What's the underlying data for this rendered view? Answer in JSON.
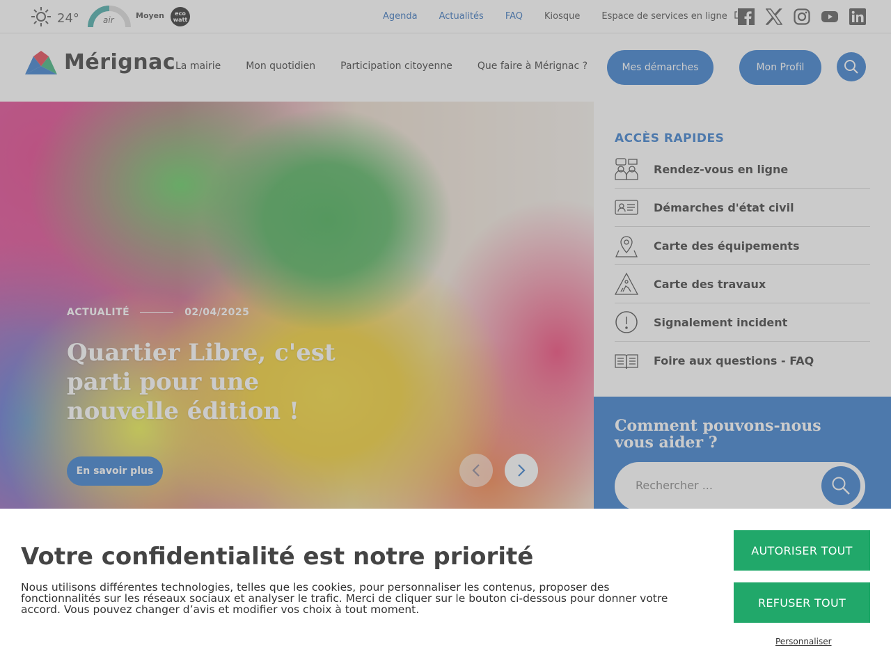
{
  "weather": {
    "icon": "sun-icon",
    "temperature": "24°"
  },
  "air_quality": {
    "label": "air",
    "level": "Moyen"
  },
  "ecowatt": {
    "line1": "eco",
    "line2": "watt"
  },
  "top_links": [
    {
      "label": "Agenda",
      "color": "#1a5fb4"
    },
    {
      "label": "Actualités",
      "color": "#1a5fb4"
    },
    {
      "label": "FAQ",
      "color": "#1a5fb4"
    },
    {
      "label": "Kiosque",
      "color": "#333333"
    },
    {
      "label": "Espace de services en ligne",
      "color": "#333333",
      "icon": "external-link-icon"
    }
  ],
  "socials": [
    "facebook-icon",
    "x-icon",
    "instagram-icon",
    "youtube-icon",
    "linkedin-icon"
  ],
  "header": {
    "logo_text": "Mérignac",
    "nav": [
      "La mairie",
      "Mon quotidien",
      "Participation citoyenne",
      "Que faire à Mérignac ?"
    ],
    "demarches_button": "Mes démarches",
    "profile_button": "Mon Profil"
  },
  "hero": {
    "category": "ACTUALITÉ",
    "date": "02/04/2025",
    "title": "Quartier Libre, c'est parti pour une nouvelle édition !",
    "cta": "En savoir plus"
  },
  "quick_access": {
    "title": "ACCÈS RAPIDES",
    "items": [
      {
        "label": "Rendez-vous en ligne",
        "icon": "appointment-icon"
      },
      {
        "label": "Démarches d'état civil",
        "icon": "id-card-icon"
      },
      {
        "label": "Carte des équipements",
        "icon": "map-pin-icon"
      },
      {
        "label": "Carte des travaux",
        "icon": "roadwork-icon"
      },
      {
        "label": "Signalement incident",
        "icon": "alert-icon"
      },
      {
        "label": "Foire aux questions - FAQ",
        "icon": "book-icon"
      }
    ]
  },
  "help": {
    "title": "Comment pouvons-nous vous aider ?",
    "placeholder": "Rechercher ..."
  },
  "cookie": {
    "title": "Votre confidentialité est notre priorité",
    "text": "Nous utilisons différentes technologies, telles que les cookies, pour personnaliser les contenus, proposer des fonctionnalités sur les réseaux sociaux et analyser le trafic. Merci de cliquer sur le bouton ci-dessous pour donner votre accord. Vous pouvez changer d’avis et modifier vos choix à tout moment.",
    "accept": "AUTORISER TOUT",
    "refuse": "REFUSER TOUT",
    "customize": "Personnaliser"
  },
  "colors": {
    "brand_blue": "#1a6ac7",
    "cookie_green": "#21a86a"
  }
}
